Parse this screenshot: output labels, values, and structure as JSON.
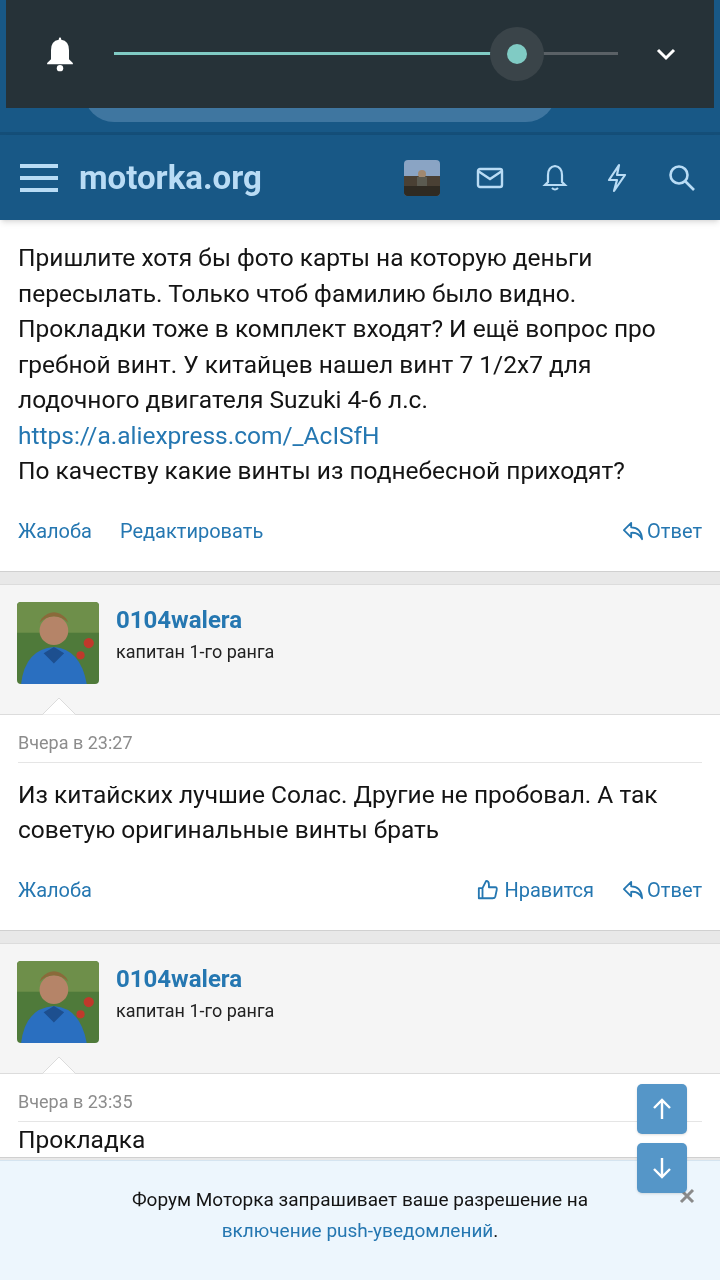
{
  "volume_panel": {
    "level": 0.8
  },
  "header": {
    "logo": "motorka.org"
  },
  "posts": [
    {
      "kind": "continued",
      "body_before": "Пришлите хотя бы фото карты на которую деньги пересылать. Только чтоб фамилию было видно. Прокладки тоже в комплект входят? И ещё вопрос про гребной винт. У китайцев нашел винт 7 1/2х7 для лодочного двигателя Suzuki 4-6 л.с.",
      "link": "https://a.aliexpress.com/_AcISfH",
      "body_after": "По качеству какие винты из поднебесной приходят?",
      "actions_left": [
        "Жалоба",
        "Редактировать"
      ],
      "reply": "Ответ"
    },
    {
      "kind": "full",
      "user": "0104walera",
      "rank": "капитан 1-го ранга",
      "date": "Вчера в 23:27",
      "body_before": "Из китайских лучшие Солас. Другие не пробовал. А так советую оригинальные винты брать",
      "actions_left": [
        "Жалоба"
      ],
      "like": "Нравится",
      "reply": "Ответ"
    },
    {
      "kind": "cut",
      "user": "0104walera",
      "rank": "капитан 1-го ранга",
      "date": "Вчера в 23:35",
      "body_before": "Прокладка"
    }
  ],
  "push_banner": {
    "text": "Форум Моторка запрашивает ваше разрешение на",
    "link": "включение push-уведомлений",
    "end": "."
  }
}
